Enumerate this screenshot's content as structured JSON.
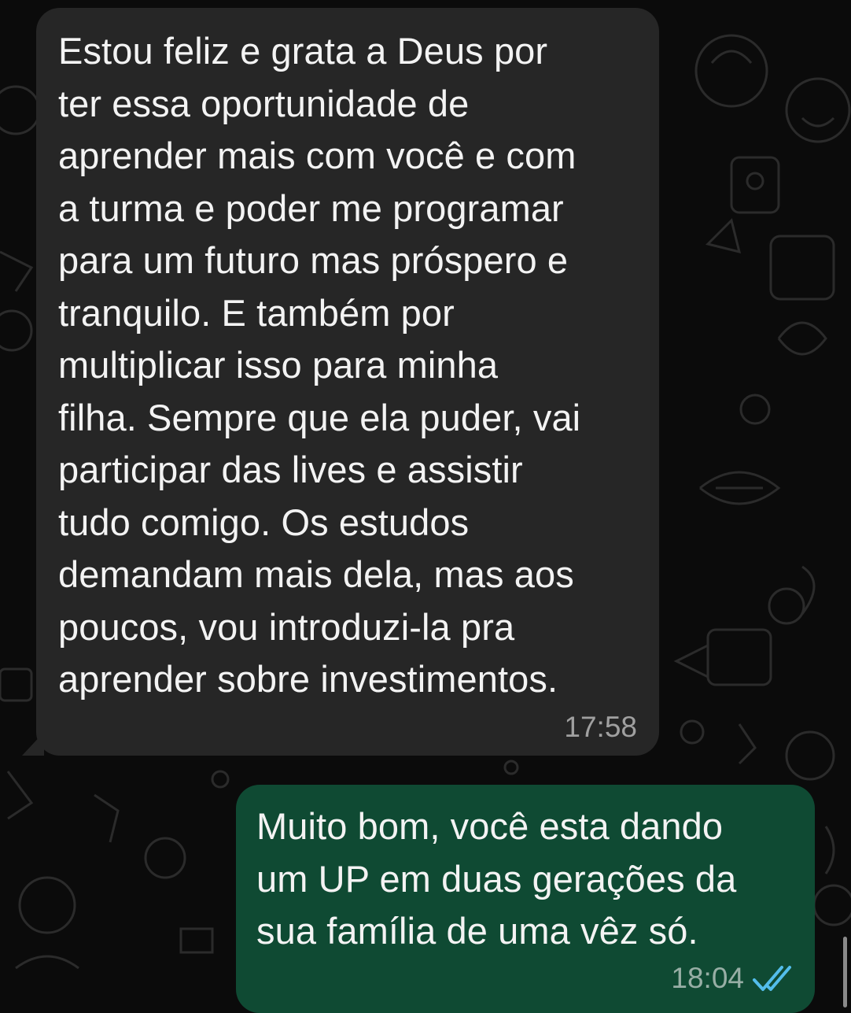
{
  "chat": {
    "messages": [
      {
        "direction": "incoming",
        "text": "Estou feliz e grata a Deus por\nter essa oportunidade de\naprender mais com você e com\na turma e poder me programar\npara um futuro mas próspero e\ntranquilo. E também por\nmultiplicar isso para minha\nfilha. Sempre que ela puder, vai\nparticipar das lives e assistir\ntudo comigo. Os estudos\ndemandam mais dela, mas aos\npoucos, vou introduzi-la pra\naprender sobre investimentos.",
        "time": "17:58"
      },
      {
        "direction": "outgoing",
        "text": "Muito bom, você esta dando\num UP em duas gerações da\nsua família de uma vêz só.",
        "time": "18:04",
        "status_icon": "double-check-read-icon"
      }
    ]
  },
  "colors": {
    "background": "#0b0b0b",
    "incoming_bubble": "#262626",
    "outgoing_bubble": "#0f4a33",
    "read_ticks": "#53bdeb"
  }
}
